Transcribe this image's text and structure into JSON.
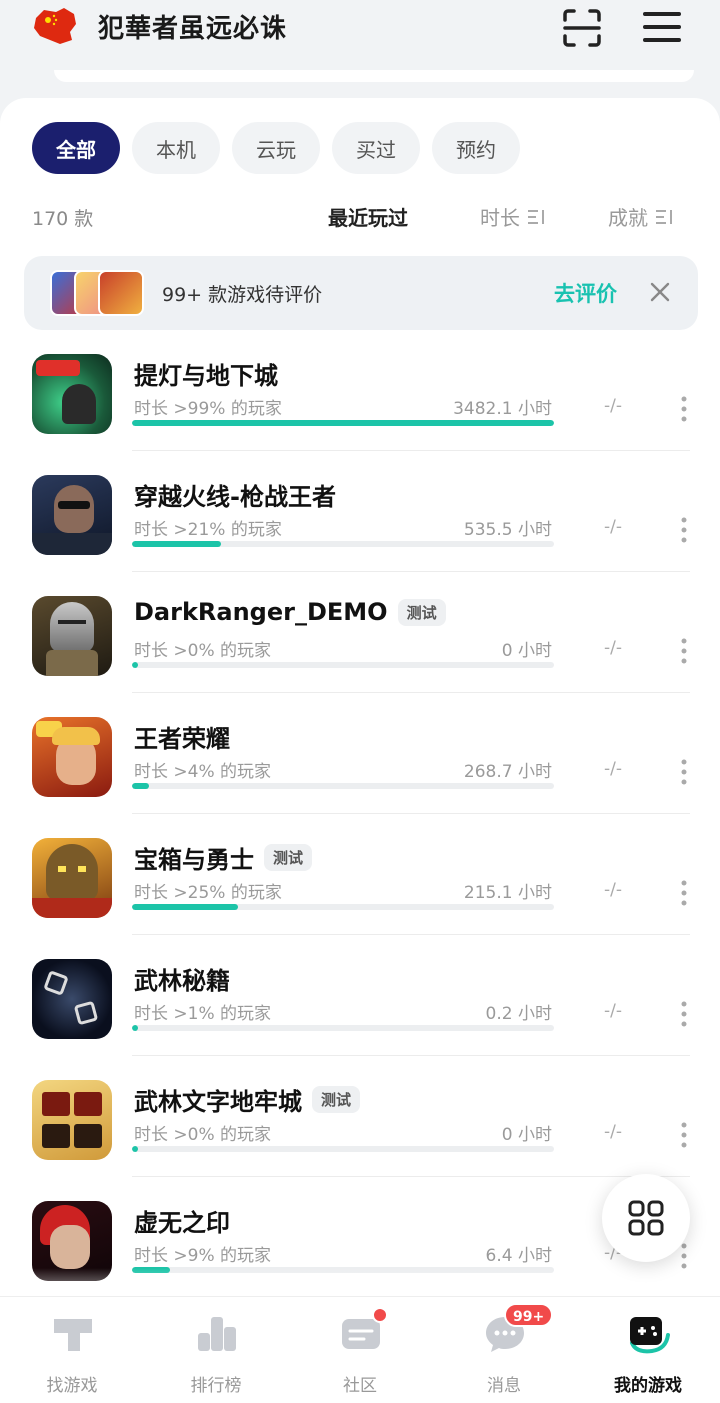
{
  "header": {
    "username": "犯華者虽远必诛",
    "flag_color": "#de2910"
  },
  "tabs": [
    {
      "label": "全部",
      "active": true
    },
    {
      "label": "本机",
      "active": false
    },
    {
      "label": "云玩",
      "active": false
    },
    {
      "label": "买过",
      "active": false
    },
    {
      "label": "预约",
      "active": false
    }
  ],
  "list_info": {
    "count": "170 款",
    "sort_recent": "最近玩过",
    "sort_duration": "时长",
    "sort_achievement": "成就"
  },
  "review_banner": {
    "text": "99+ 款游戏待评价",
    "action": "去评价"
  },
  "games": [
    {
      "name": "提灯与地下城",
      "tag": "",
      "pct": "时长 >99% 的玩家",
      "hours": "3482.1 小时",
      "progress": 1.0,
      "ach": "-/-"
    },
    {
      "name": "穿越火线-枪战王者",
      "tag": "",
      "pct": "时长 >21% 的玩家",
      "hours": "535.5 小时",
      "progress": 0.21,
      "ach": "-/-"
    },
    {
      "name": "DarkRanger_DEMO",
      "tag": "测试",
      "pct": "时长 >0% 的玩家",
      "hours": "0 小时",
      "progress": 0.01,
      "ach": "-/-"
    },
    {
      "name": "王者荣耀",
      "tag": "",
      "pct": "时长 >4% 的玩家",
      "hours": "268.7 小时",
      "progress": 0.04,
      "ach": "-/-"
    },
    {
      "name": "宝箱与勇士",
      "tag": "测试",
      "pct": "时长 >25% 的玩家",
      "hours": "215.1 小时",
      "progress": 0.25,
      "ach": "-/-"
    },
    {
      "name": "武林秘籍",
      "tag": "",
      "pct": "时长 >1% 的玩家",
      "hours": "0.2 小时",
      "progress": 0.01,
      "ach": "-/-"
    },
    {
      "name": "武林文字地牢城",
      "tag": "测试",
      "pct": "时长 >0% 的玩家",
      "hours": "0 小时",
      "progress": 0.01,
      "ach": "-/-"
    },
    {
      "name": "虚无之印",
      "tag": "",
      "pct": "时长 >9% 的玩家",
      "hours": "6.4 小时",
      "progress": 0.09,
      "ach": "-/-"
    }
  ],
  "bottom_nav": [
    {
      "label": "找游戏",
      "icon": "find-games-icon",
      "active": false
    },
    {
      "label": "排行榜",
      "icon": "leaderboard-icon",
      "active": false
    },
    {
      "label": "社区",
      "icon": "community-icon",
      "active": false
    },
    {
      "label": "消息",
      "icon": "messages-icon",
      "active": false
    },
    {
      "label": "我的游戏",
      "icon": "my-games-icon",
      "active": true
    }
  ],
  "badges": {
    "messages": "99+"
  },
  "colors": {
    "accent": "#1cc4a8",
    "active_tab": "#1b1f6e",
    "badge": "#f14a4a"
  }
}
